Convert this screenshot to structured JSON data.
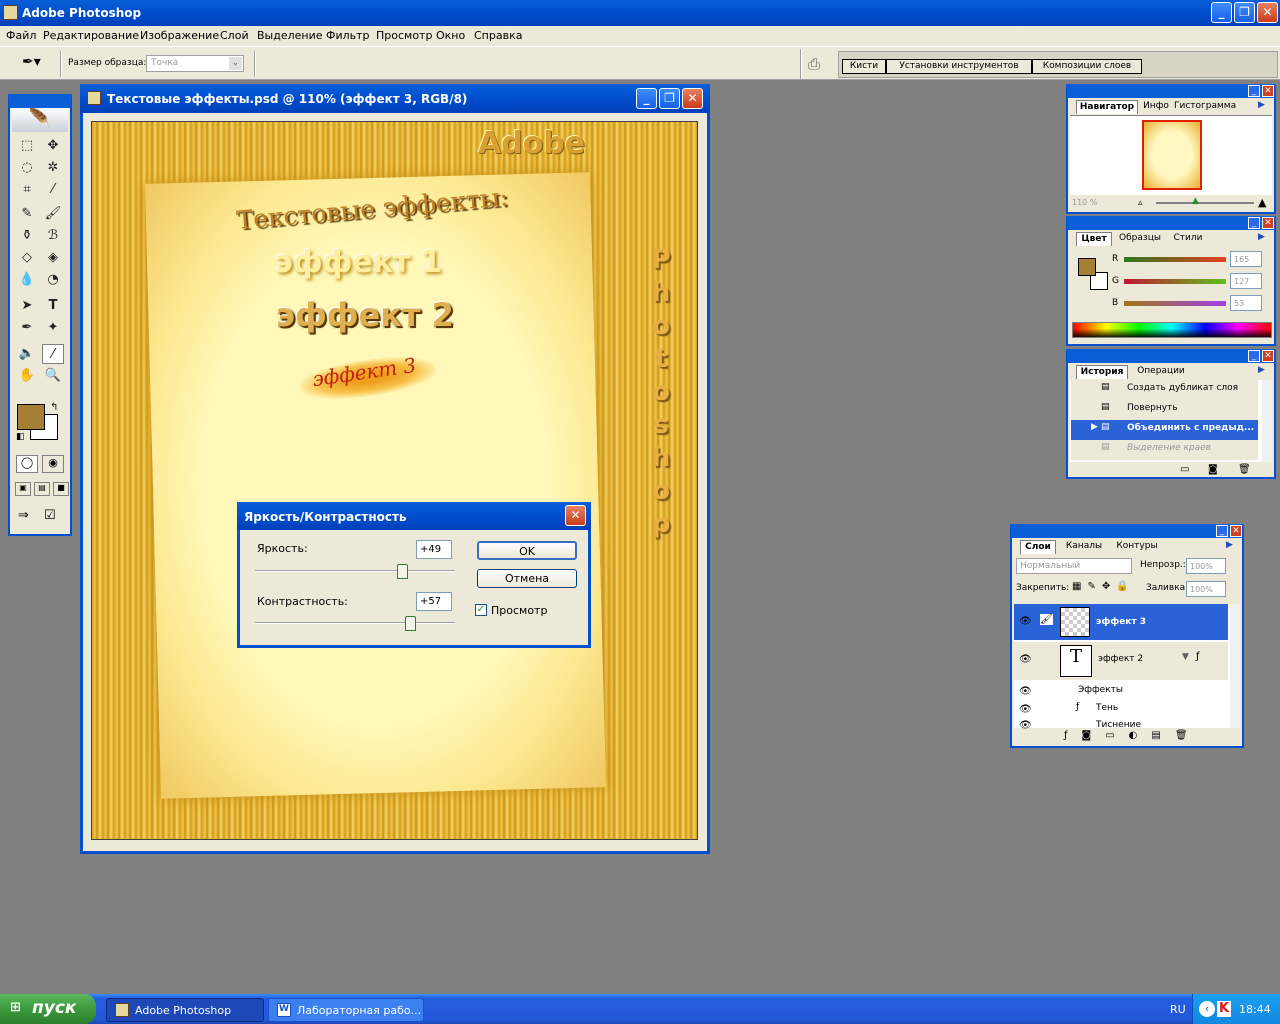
{
  "app": {
    "title": "Adobe Photoshop"
  },
  "menu": [
    "Файл",
    "Редактирование",
    "Изображение",
    "Слой",
    "Выделение",
    "Фильтр",
    "Просмотр",
    "Окно",
    "Справка"
  ],
  "options": {
    "sample_size_label": "Размер образца:",
    "sample_size_value": "Точка"
  },
  "palette_well": {
    "tabs": [
      "Кисти",
      "Установки инструментов",
      "Композиции слоев"
    ]
  },
  "document": {
    "title": "Текстовые эффекты.psd @ 110% (эффект 3, RGB/8)",
    "canvas_text": {
      "adobe": "Adobe",
      "heading": "Текстовые эффекты:",
      "effect1": "эффект 1",
      "effect2": "эффект 2",
      "effect3": "эффект 3",
      "vertical": "Photoshop"
    }
  },
  "dialog": {
    "title": "Яркость/Контрастность",
    "brightness_label": "Яркость:",
    "brightness_value": "+49",
    "brightness_level": 0.74,
    "contrast_label": "Контрастность:",
    "contrast_value": "+57",
    "contrast_level": 0.78,
    "ok": "OK",
    "cancel": "Отмена",
    "preview_label": "Просмотр",
    "preview_checked": true
  },
  "navigator": {
    "tabs": [
      "Навигатор",
      "Инфо",
      "Гистограмма"
    ],
    "zoom": "110 %"
  },
  "color": {
    "tabs": [
      "Цвет",
      "Образцы",
      "Стили"
    ],
    "foreground": "#a57f35",
    "channels": [
      {
        "name": "R",
        "value": "165"
      },
      {
        "name": "G",
        "value": "127"
      },
      {
        "name": "B",
        "value": "53"
      }
    ]
  },
  "history": {
    "tabs": [
      "История",
      "Операции"
    ],
    "items": [
      "Создать дубликат слоя",
      "Повернуть",
      "Объединить с предыд...",
      "Выделение краев"
    ],
    "selected_index": 2
  },
  "layers": {
    "tabs": [
      "Слои",
      "Каналы",
      "Контуры"
    ],
    "blend_mode": "Нормальный",
    "opacity_label": "Непрозр.:",
    "opacity": "100%",
    "lock_label": "Закрепить:",
    "fill_label": "Заливка:",
    "fill": "100%",
    "rows": [
      {
        "name": "эффект 3",
        "selected": true
      },
      {
        "name": "эффект 2",
        "selected": false
      }
    ],
    "effects_label": "Эффекты",
    "effects": [
      "Тень",
      "Тиснение"
    ]
  },
  "taskbar": {
    "start": "пуск",
    "tasks": [
      "Adobe Photoshop",
      "Лабораторная рабо..."
    ],
    "lang": "RU",
    "clock": "18:44"
  }
}
